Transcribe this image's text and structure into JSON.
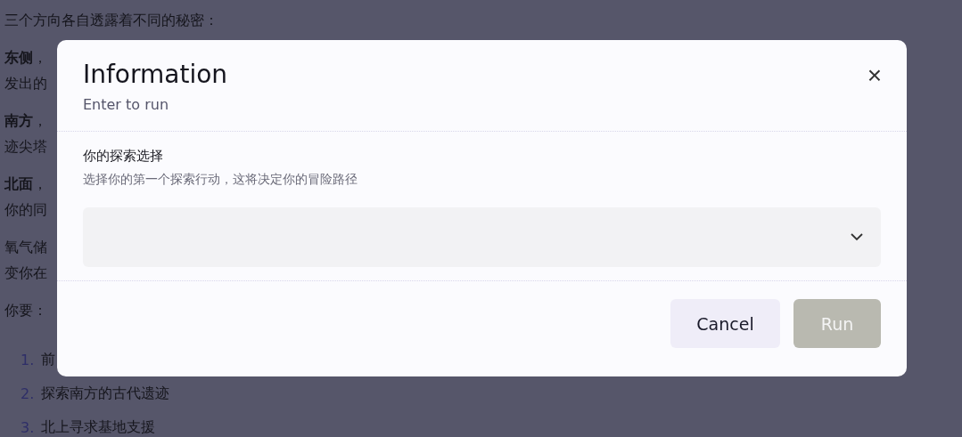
{
  "background": {
    "paragraphs": [
      {
        "lines": [
          "三个方向各自透露着不同的秘密："
        ]
      },
      {
        "lines": [
          "**东侧**，",
          "发出的"
        ]
      },
      {
        "lines": [
          "**南方**，",
          "迹尖塔"
        ]
      },
      {
        "lines": [
          "**北面**，",
          "你的同"
        ]
      },
      {
        "lines": [
          "氧气储",
          "变你在"
        ]
      },
      {
        "lines": [
          "你要："
        ]
      }
    ],
    "list": [
      {
        "number": "1.",
        "text": "前"
      },
      {
        "number": "2.",
        "text": "探索南方的古代遗迹"
      },
      {
        "number": "3.",
        "text": "北上寻求基地支援"
      }
    ]
  },
  "dialog": {
    "title": "Information",
    "subtitle": "Enter to run",
    "close": "×",
    "field": {
      "label": "你的探索选择",
      "description": "选择你的第一个探索行动，这将决定你的冒险路径"
    },
    "buttons": [
      {
        "label": "Cancel",
        "kind": "secondary",
        "disabled": false
      },
      {
        "label": "Run",
        "kind": "primary",
        "disabled": true
      }
    ]
  }
}
